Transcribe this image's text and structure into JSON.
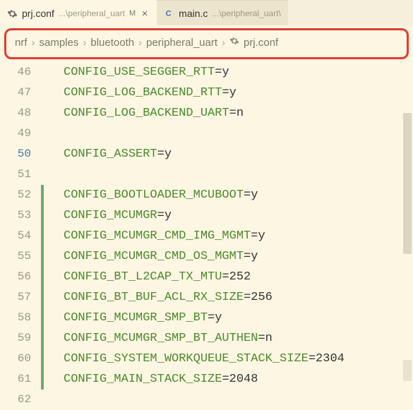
{
  "tabs": [
    {
      "title": "prj.conf",
      "subtitle": "...\\peripheral_uart",
      "modified": "M",
      "icon": "gear-icon",
      "active": true
    },
    {
      "title": "main.c",
      "subtitle": "...\\peripheral_uart\\",
      "icon": "c-icon",
      "active": false
    }
  ],
  "breadcrumb": {
    "items": [
      "nrf",
      "samples",
      "bluetooth",
      "peripheral_uart",
      "prj.conf"
    ],
    "sep": "›"
  },
  "lines": [
    {
      "num": "46",
      "changed": false,
      "key": "CONFIG_USE_SEGGER_RTT",
      "val": "=y"
    },
    {
      "num": "47",
      "changed": false,
      "key": "CONFIG_LOG_BACKEND_RTT",
      "val": "=y"
    },
    {
      "num": "48",
      "changed": false,
      "key": "CONFIG_LOG_BACKEND_UART",
      "val": "=n"
    },
    {
      "num": "49",
      "changed": false,
      "key": "",
      "val": ""
    },
    {
      "num": "50",
      "changed": false,
      "key": "CONFIG_ASSERT",
      "val": "=y"
    },
    {
      "num": "51",
      "changed": false,
      "key": "",
      "val": ""
    },
    {
      "num": "52",
      "changed": true,
      "key": "CONFIG_BOOTLOADER_MCUBOOT",
      "val": "=y"
    },
    {
      "num": "53",
      "changed": true,
      "key": "CONFIG_MCUMGR",
      "val": "=y"
    },
    {
      "num": "54",
      "changed": true,
      "key": "CONFIG_MCUMGR_CMD_IMG_MGMT",
      "val": "=y"
    },
    {
      "num": "55",
      "changed": true,
      "key": "CONFIG_MCUMGR_CMD_OS_MGMT",
      "val": "=y"
    },
    {
      "num": "56",
      "changed": true,
      "key": "CONFIG_BT_L2CAP_TX_MTU",
      "val": "=252"
    },
    {
      "num": "57",
      "changed": true,
      "key": "CONFIG_BT_BUF_ACL_RX_SIZE",
      "val": "=256"
    },
    {
      "num": "58",
      "changed": true,
      "key": "CONFIG_MCUMGR_SMP_BT",
      "val": "=y"
    },
    {
      "num": "59",
      "changed": true,
      "key": "CONFIG_MCUMGR_SMP_BT_AUTHEN",
      "val": "=n"
    },
    {
      "num": "60",
      "changed": true,
      "key": "CONFIG_SYSTEM_WORKQUEUE_STACK_SIZE",
      "val": "=2304"
    },
    {
      "num": "61",
      "changed": true,
      "key": "CONFIG_MAIN_STACK_SIZE",
      "val": "=2048"
    },
    {
      "num": "62",
      "changed": false,
      "key": "",
      "val": ""
    }
  ]
}
